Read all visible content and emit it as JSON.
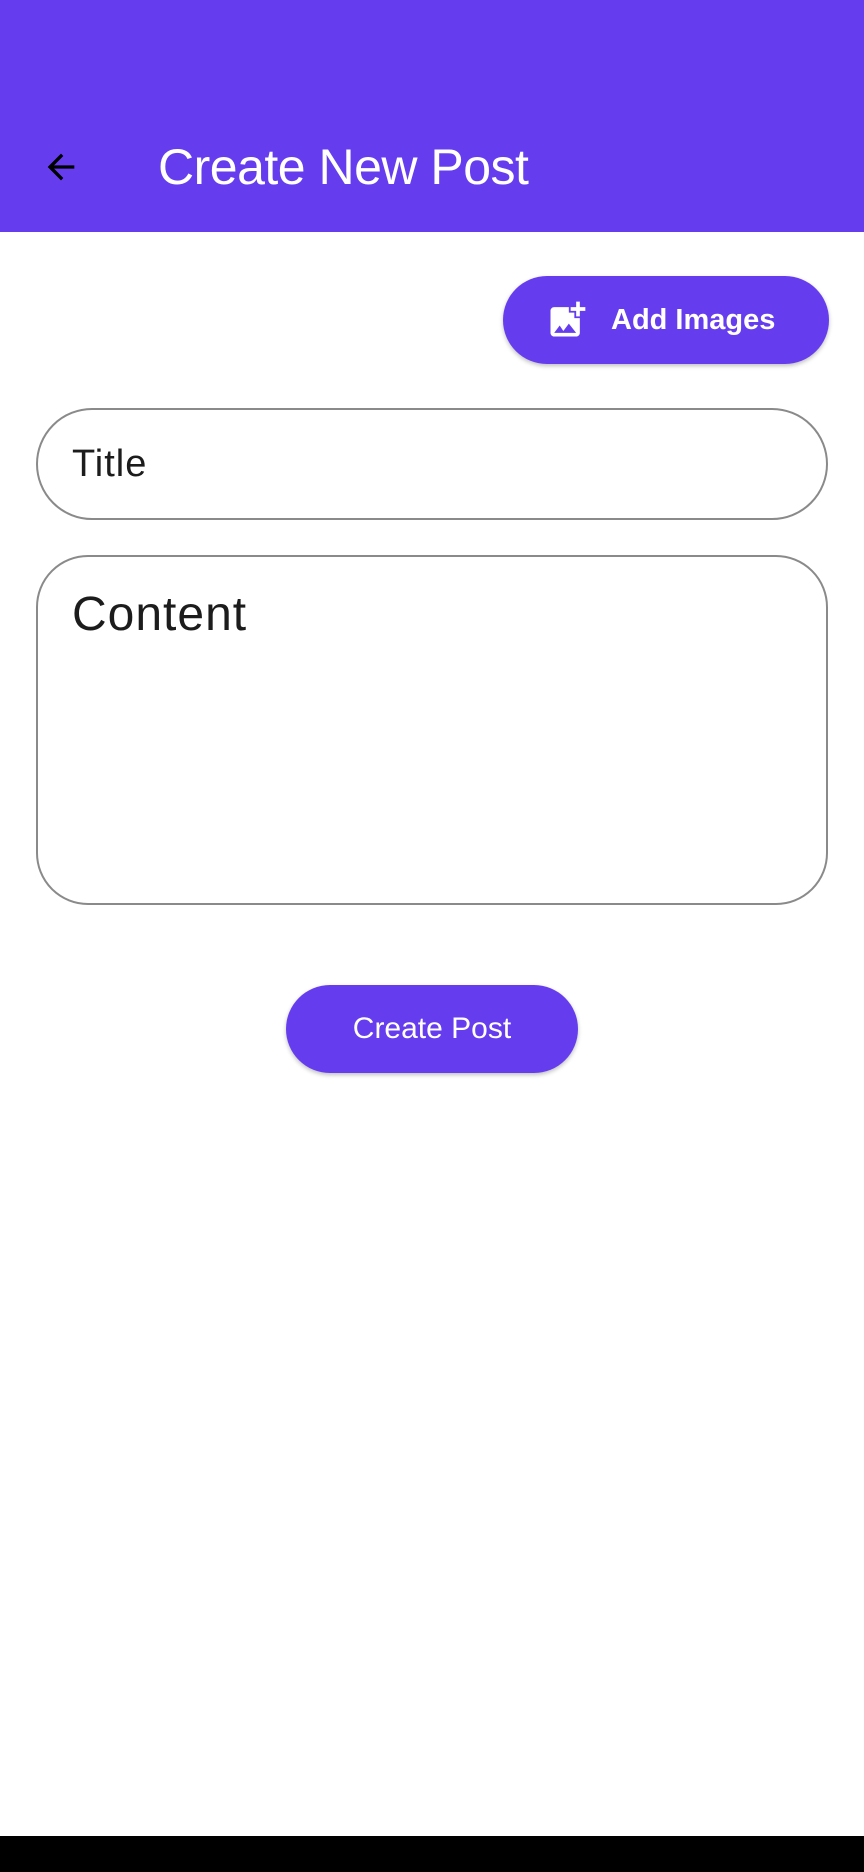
{
  "header": {
    "title": "Create New Post",
    "back_icon": "arrow-left-icon"
  },
  "actions": {
    "add_images_label": "Add Images",
    "add_images_icon": "add-photo-icon"
  },
  "form": {
    "title_placeholder": "Title",
    "title_value": "",
    "content_placeholder": "Content",
    "content_value": ""
  },
  "submit": {
    "create_post_label": "Create Post"
  },
  "colors": {
    "primary": "#653DEF",
    "on_primary": "#FFFFFF",
    "field_border": "#8A8A8A",
    "background": "#FFFFFF",
    "system_nav": "#000000"
  }
}
